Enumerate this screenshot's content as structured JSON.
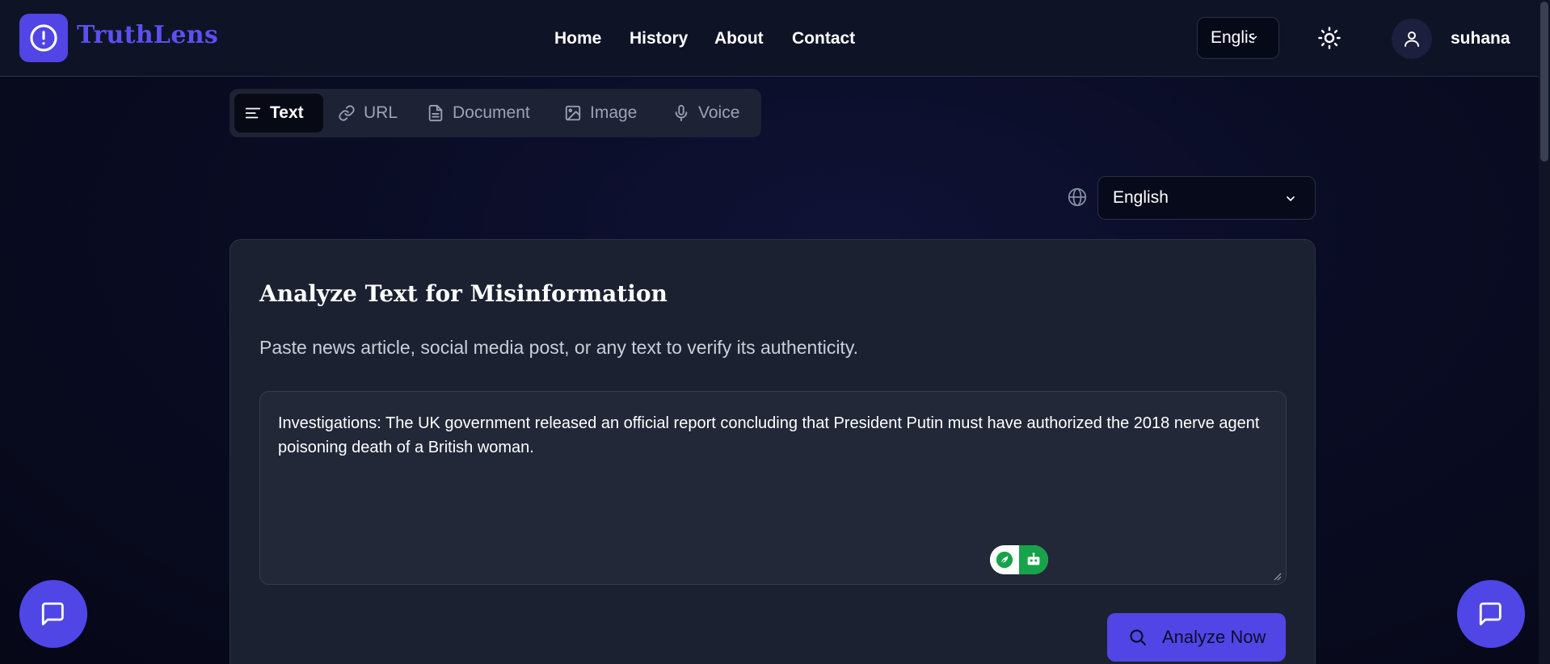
{
  "app": {
    "brand": "TruthLens",
    "accent": "#5145e5"
  },
  "nav": {
    "links": [
      "Home",
      "History",
      "About",
      "Contact"
    ]
  },
  "header": {
    "language_short": "English",
    "username": "suhana"
  },
  "tabs": [
    {
      "label": "Text",
      "icon": "text-lines-icon",
      "active": true
    },
    {
      "label": "URL",
      "icon": "link-icon"
    },
    {
      "label": "Document",
      "icon": "document-icon"
    },
    {
      "label": "Image",
      "icon": "image-icon"
    },
    {
      "label": "Voice",
      "icon": "microphone-icon"
    }
  ],
  "language_select": {
    "value": "English"
  },
  "card": {
    "title": "Analyze Text for Misinformation",
    "subtitle": "Paste news article, social media post, or any text to verify its authenticity.",
    "input_text": "Investigations: The UK government released an official report concluding that President Putin must have authorized the 2018 nerve agent poisoning death of a British woman.",
    "analyze_label": "Analyze Now"
  }
}
